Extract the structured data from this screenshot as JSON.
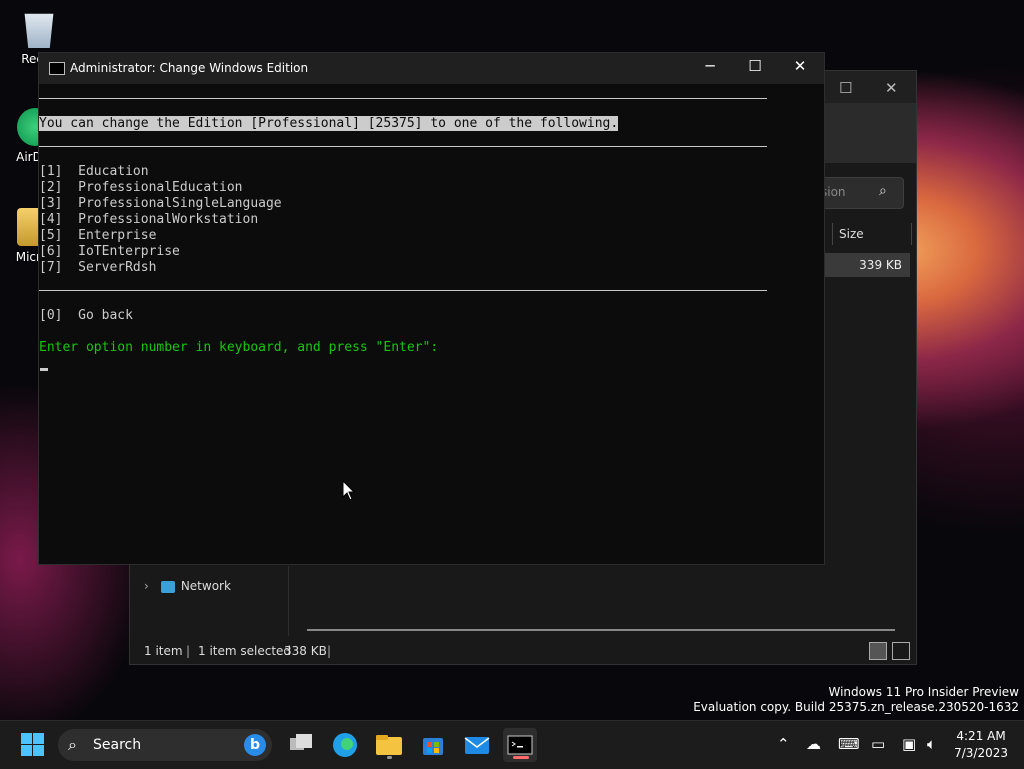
{
  "desktop": {
    "icons": [
      {
        "label": "Recyc"
      },
      {
        "label": "AirDro"
      },
      {
        "label": "Micros"
      }
    ]
  },
  "explorer": {
    "search_placeholder": "sion",
    "column_size": "Size",
    "file_size": "339 KB",
    "nav_network": "Network",
    "status_items": "1 item",
    "status_selected": "1 item selected",
    "status_size": "338 KB",
    "separator": "|"
  },
  "console": {
    "title": "Administrator:  Change Windows Edition",
    "header": "You can change the Edition [Professional] [25375] to one of the following.",
    "options": [
      "[1]  Education",
      "[2]  ProfessionalEducation",
      "[3]  ProfessionalSingleLanguage",
      "[4]  ProfessionalWorkstation",
      "[5]  Enterprise",
      "[6]  IoTEnterprise",
      "[7]  ServerRdsh"
    ],
    "go_back": "[0]  Go back",
    "prompt": "Enter option number in keyboard, and press \"Enter\":",
    "colors": {
      "prompt": "#16c60c",
      "text": "#cccccc",
      "background": "#0c0c0c"
    }
  },
  "watermark": {
    "line1": "Windows 11 Pro Insider Preview",
    "line2": "Evaluation copy. Build 25375.zn_release.230520-1632"
  },
  "taskbar": {
    "search_label": "Search",
    "bing_glyph": "b",
    "clock_time": "4:21 AM",
    "clock_date": "7/3/2023",
    "accent": "#4cc2ff"
  }
}
